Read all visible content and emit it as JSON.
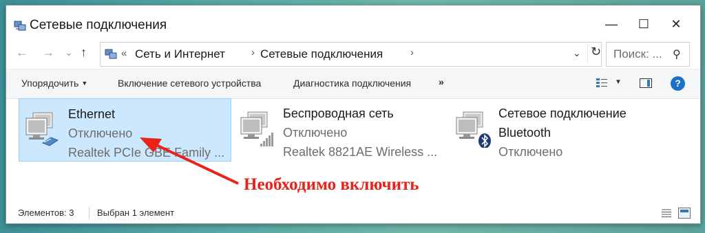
{
  "window": {
    "title": "Сетевые подключения",
    "controls": {
      "minimize": "—",
      "maximize": "☐",
      "close": "✕"
    }
  },
  "navigation": {
    "back": "←",
    "forward": "→",
    "recent": "⌄",
    "up": "↑"
  },
  "address": {
    "overflow": "«",
    "crumbs": [
      "Сеть и Интернет",
      "Сетевые подключения"
    ],
    "separator": "›",
    "dropdown": "⌄",
    "refresh": "↻"
  },
  "search": {
    "placeholder": "Поиск: ...",
    "icon": "⚲"
  },
  "commands": {
    "organize": "Упорядочить",
    "enable_device": "Включение сетевого устройства",
    "diagnose": "Диагностика подключения",
    "more": "»"
  },
  "connections": [
    {
      "name": "Ethernet",
      "status": "Отключено",
      "device": "Realtek PCIe GBE Family ...",
      "icon": "ethernet-icon",
      "selected": true
    },
    {
      "name": "Беспроводная сеть",
      "status": "Отключено",
      "device": "Realtek 8821AE Wireless ...",
      "icon": "wireless-icon",
      "selected": false
    },
    {
      "name": "Сетевое подключение",
      "name_line2": "Bluetooth",
      "status": "Отключено",
      "icon": "bluetooth-icon",
      "selected": false
    }
  ],
  "annotation": {
    "text": "Необходимо включить",
    "color": "#e8231a"
  },
  "statusbar": {
    "items_count": "Элементов: 3",
    "selected": "Выбран 1 элемент"
  },
  "colors": {
    "selection": "#cce8ff",
    "accent": "#1d6fc7"
  }
}
